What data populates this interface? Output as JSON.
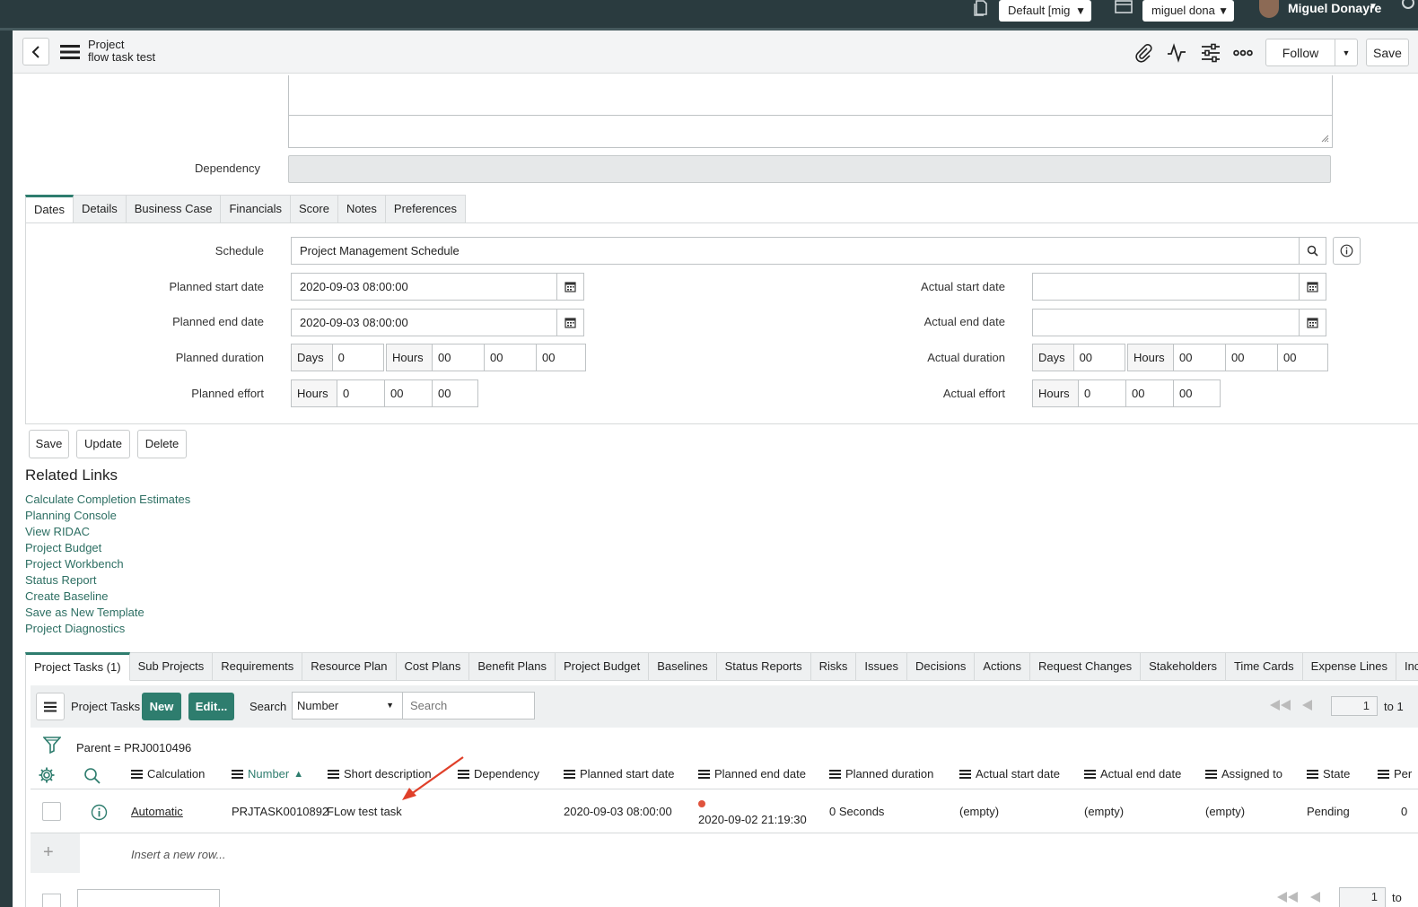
{
  "topbar": {
    "app_select": "Default [mig",
    "user_select": "miguel dona",
    "user_name": "Miguel Donayre"
  },
  "header": {
    "record_type": "Project",
    "record_name": "flow task test",
    "follow_label": "Follow",
    "save_label": "Save"
  },
  "form": {
    "dependency_label": "Dependency",
    "tabs": [
      "Dates",
      "Details",
      "Business Case",
      "Financials",
      "Score",
      "Notes",
      "Preferences"
    ],
    "schedule_label": "Schedule",
    "schedule_value": "Project Management Schedule",
    "planned_start_label": "Planned start date",
    "planned_start_value": "2020-09-03 08:00:00",
    "planned_end_label": "Planned end date",
    "planned_end_value": "2020-09-03 08:00:00",
    "planned_duration_label": "Planned duration",
    "planned_effort_label": "Planned effort",
    "actual_start_label": "Actual start date",
    "actual_end_label": "Actual end date",
    "actual_duration_label": "Actual duration",
    "actual_effort_label": "Actual effort",
    "days_label": "Days",
    "hours_label": "Hours",
    "planned_duration_days": "0",
    "planned_duration_h": "00",
    "planned_duration_m": "00",
    "planned_duration_s": "00",
    "planned_effort_h": "0",
    "planned_effort_m": "00",
    "planned_effort_s": "00",
    "actual_duration_days": "00",
    "actual_duration_h": "00",
    "actual_duration_m": "00",
    "actual_duration_s": "00",
    "actual_effort_h": "0",
    "actual_effort_m": "00",
    "actual_effort_s": "00"
  },
  "actions": {
    "save": "Save",
    "update": "Update",
    "delete": "Delete"
  },
  "related_links": {
    "title": "Related Links",
    "items": [
      "Calculate Completion Estimates",
      "Planning Console",
      "View RIDAC",
      "Project Budget",
      "Project Workbench",
      "Status Report",
      "Create Baseline",
      "Save as New Template",
      "Project Diagnostics"
    ]
  },
  "related_tabs": [
    "Project Tasks (1)",
    "Sub Projects",
    "Requirements",
    "Resource Plan",
    "Cost Plans",
    "Benefit Plans",
    "Project Budget",
    "Baselines",
    "Status Reports",
    "Risks",
    "Issues",
    "Decisions",
    "Actions",
    "Request Changes",
    "Stakeholders",
    "Time Cards",
    "Expense Lines",
    "Incidents"
  ],
  "list": {
    "title": "Project Tasks",
    "new_label": "New",
    "edit_label": "Edit...",
    "search_label": "Search",
    "search_field": "Number",
    "search_placeholder": "Search",
    "page_value": "1",
    "page_to": "to 1",
    "filter": "Parent = PRJ0010496",
    "columns": [
      "Calculation",
      "Number",
      "Short description",
      "Dependency",
      "Planned start date",
      "Planned end date",
      "Planned duration",
      "Actual start date",
      "Actual end date",
      "Assigned to",
      "State",
      "Per"
    ],
    "row": {
      "calculation": "Automatic",
      "number": "PRJTASK0010892",
      "short_description": "FLow test task",
      "planned_start": "2020-09-03 08:00:00",
      "planned_end": "2020-09-02 21:19:30",
      "planned_duration": "0 Seconds",
      "actual_start": "(empty)",
      "actual_end": "(empty)",
      "assigned_to": "(empty)",
      "state": "Pending",
      "per": "0"
    },
    "insert_row": "Insert a new row...",
    "bottom_page_value": "1",
    "bottom_page_to": "to"
  },
  "colors": {
    "topbar": "#2a3b3f",
    "accent": "#2e7d6e",
    "link": "#2d6f63",
    "alert": "#e0533d"
  }
}
